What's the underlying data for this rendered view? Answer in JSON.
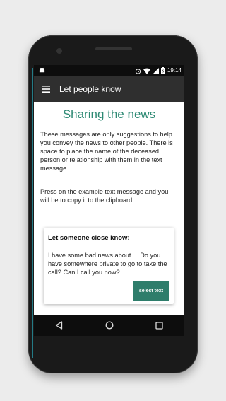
{
  "status_bar": {
    "time": "19:14",
    "icons": [
      "android-icon",
      "alarm-icon",
      "wifi-icon",
      "signal-icon",
      "battery-charging-icon"
    ]
  },
  "app_bar": {
    "title": "Let people know",
    "menu_icon": "hamburger-menu-icon"
  },
  "content": {
    "title": "Sharing the news",
    "paragraph_1": "These messages are only suggestions to help you convey the news to other people. There is space to place the name of the deceased person or relationship with them in the text message.",
    "paragraph_2": "Press on the example text message and you will be to copy it to the clipboard.",
    "card": {
      "title": "Let someone close know:",
      "message": "I have some bad news about ... Do you have somewhere private to go to take the call? Can I call you now?",
      "button_label": "select text"
    }
  },
  "nav_bar": {
    "icons": [
      "back-icon",
      "home-icon",
      "recents-icon"
    ]
  },
  "colors": {
    "accent": "#2e8a74",
    "button": "#2e7d6b",
    "app_bar": "#2f2f2f",
    "status_bar": "#0d0d0d"
  }
}
